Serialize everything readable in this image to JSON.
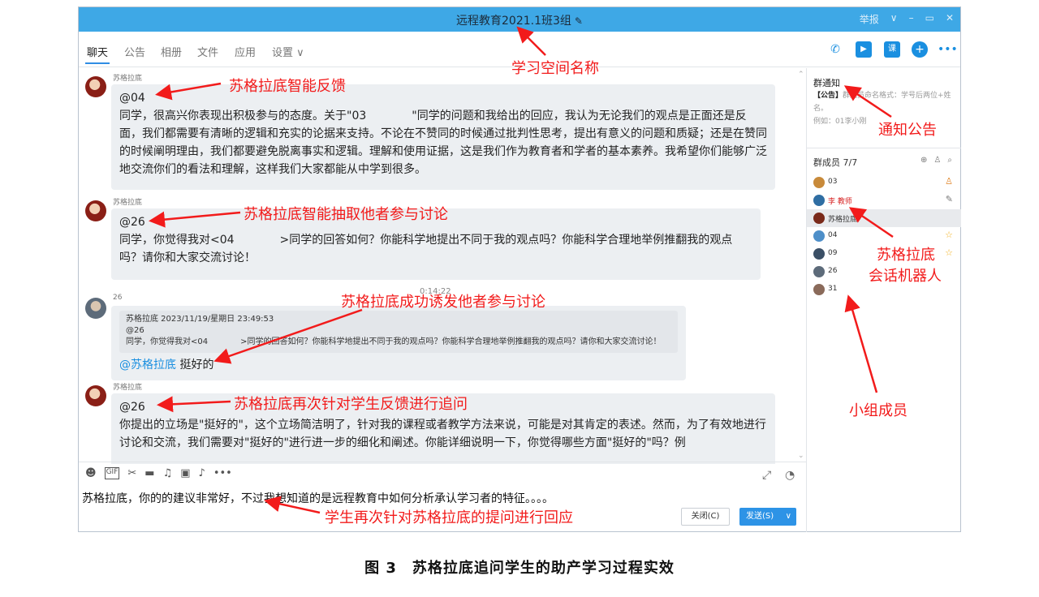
{
  "window": {
    "title": "远程教育2021.1班3组",
    "title_icon": "pen-icon",
    "controls": [
      "举报",
      "∨",
      "–",
      "▭",
      "✕"
    ]
  },
  "tabs": [
    "聊天",
    "公告",
    "相册",
    "文件",
    "应用",
    "设置 ∨"
  ],
  "toolbar": {
    "icons": [
      "phone-icon",
      "video-icon",
      "class-icon",
      "add-icon",
      "more-icon"
    ],
    "class_label": "课"
  },
  "messages": [
    {
      "sender": "苏格拉底",
      "mention": "@04",
      "text": "同学，很高兴你表现出积极参与的态度。关于\"03　　　　\"同学的问题和我给出的回应，我认为无论我们的观点是正面还是反面，我们都需要有清晰的逻辑和充实的论据来支持。不论在不赞同的时候通过批判性思考，提出有意义的问题和质疑；还是在赞同的时候阐明理由，我们都要避免脱离事实和逻辑。理解和使用证据，这是我们作为教育者和学者的基本素养。我希望你们能够广泛地交流你们的看法和理解，这样我们大家都能从中学到很多。"
    },
    {
      "sender": "苏格拉底",
      "mention": "@26",
      "text": "同学，你觉得我对<04　　　　>同学的回答如何？你能科学地提出不同于我的观点吗？你能科学合理地举例推翻我的观点吗？请你和大家交流讨论！"
    },
    {
      "time": "0:14:22",
      "sender": "26",
      "quote_header": "苏格拉底  2023/11/19/星期日 23:49:53",
      "quote_mention": "@26",
      "quote_text": "同学，你觉得我对<04　　　　>同学的回答如何？你能科学地提出不同于我的观点吗？你能科学合理地举例推翻我的观点吗？请你和大家交流讨论！",
      "at_name": "@苏格拉底",
      "reply": " 挺好的"
    },
    {
      "sender": "苏格拉底",
      "mention": "@26",
      "text": "你提出的立场是\"挺好的\"，这个立场简洁明了，针对我的课程或者教学方法来说，可能是对其肯定的表述。然而，为了有效地进行讨论和交流，我们需要对\"挺好的\"进行进一步的细化和阐述。你能详细说明一下，你觉得哪些方面\"挺好的\"吗？例"
    }
  ],
  "compose": {
    "icons": [
      "emoji-icon",
      "gif-icon",
      "scissors-icon",
      "folder-icon",
      "music-icon",
      "image-icon",
      "bell-icon",
      "more-icon"
    ],
    "text": "苏格拉底，你的的建议非常好，不过我想知道的是远程教育中如何分析承认学习者的特征。。。。",
    "close_label": "关闭(C)",
    "send_label": "发送(S)"
  },
  "sidebar": {
    "notice_title": "群通知",
    "notice_tag": "【公告】",
    "notice_text": "群成员命名格式：学号后两位+姓名。",
    "notice_example": "例如：01李小刚",
    "members_title": "群成员 7/7",
    "members": [
      {
        "name": "03",
        "badge": "person-icon"
      },
      {
        "name": "李 教师",
        "badge": "pen-icon"
      },
      {
        "name": "苏格拉底",
        "badge": ""
      },
      {
        "name": "04",
        "badge": "star-icon"
      },
      {
        "name": "09",
        "badge": "star-icon"
      },
      {
        "name": "26",
        "badge": ""
      },
      {
        "name": "31",
        "badge": ""
      }
    ]
  },
  "annotations": {
    "space_name": "学习空间名称",
    "feedback": "苏格拉底智能反馈",
    "extract": "苏格拉底智能抽取他者参与讨论",
    "induce": "苏格拉底成功诱发他者参与讨论",
    "followup": "苏格拉底再次针对学生反馈进行追问",
    "notice": "通知公告",
    "bot_line1": "苏格拉底",
    "bot_line2": "会话机器人",
    "members": "小组成员",
    "student_reply": "学生再次针对苏格拉底的提问进行回应"
  },
  "caption": "图 3　苏格拉底追问学生的助产学习过程实效",
  "colors": {
    "titlebar": "#3ea8e6",
    "annotation": "#f21b1b",
    "bubble": "#eceff2",
    "send_button": "#2d93e6"
  }
}
